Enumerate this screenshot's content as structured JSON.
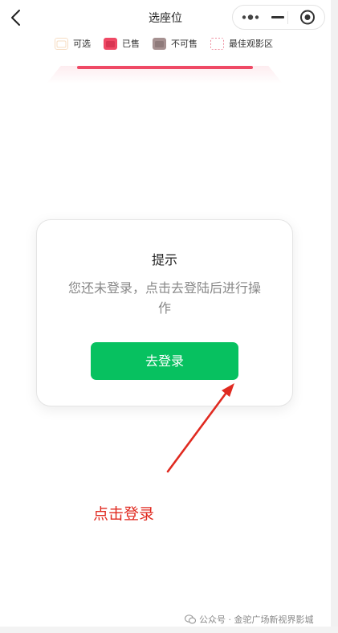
{
  "nav": {
    "title": "选座位",
    "back_icon": "chevron-left-icon",
    "more_icon": "more-dots-icon",
    "minimize_icon": "minimize-icon",
    "close_icon": "target-close-icon"
  },
  "legend": [
    {
      "label": "可选",
      "icon": "seat-available-icon",
      "color": "#f6dcc2"
    },
    {
      "label": "已售",
      "icon": "seat-sold-icon",
      "color": "#ef4965"
    },
    {
      "label": "不可售",
      "icon": "seat-unavailable-icon",
      "color": "#a69191"
    },
    {
      "label": "最佳观影区",
      "icon": "best-area-icon",
      "color": "#ef8fa0"
    }
  ],
  "screen": {
    "color": "#ef4965"
  },
  "modal": {
    "title": "提示",
    "message": "您还未登录，点击去登陆后进行操作",
    "login_button": "去登录",
    "button_color": "#07c160"
  },
  "annotation": {
    "text": "点击登录",
    "color": "#e02a20"
  },
  "watermark": {
    "text": "公众号 · 金驼广场新视界影城",
    "icon": "wechat-icon"
  }
}
